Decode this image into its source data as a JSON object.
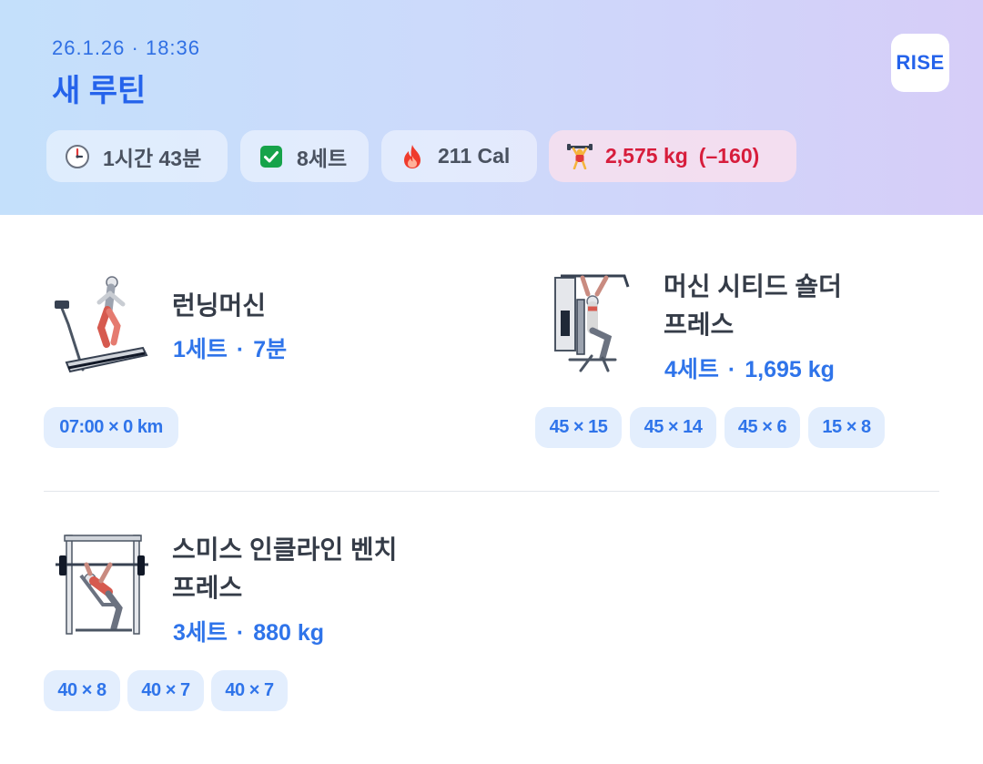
{
  "header": {
    "datetime": "26.1.26 · 18:36",
    "title": "새 루틴",
    "logo": "RISE",
    "stats": {
      "duration": "1시간 43분",
      "sets": "8세트",
      "calories": "211 Cal",
      "weight": "2,575 kg",
      "weight_delta": "(–160)"
    },
    "icons": {
      "duration": "clock-icon",
      "sets": "checkbox-icon",
      "calories": "fire-icon",
      "weight": "muscle-figure-icon"
    }
  },
  "exercises": [
    {
      "name_line1": "런닝머신",
      "name_line2": "",
      "meta_sets": "1세트",
      "meta_value": "7분",
      "sets": [
        "07:00 × 0 km"
      ]
    },
    {
      "name_line1": "머신 시티드 숄더",
      "name_line2": "프레스",
      "meta_sets": "4세트",
      "meta_value": "1,695 kg",
      "sets": [
        "45 × 15",
        "45 × 14",
        "45 × 6",
        "15 × 8"
      ]
    },
    {
      "name_line1": "스미스 인클라인 벤치",
      "name_line2": "프레스",
      "meta_sets": "3세트",
      "meta_value": "880 kg",
      "sets": [
        "40 × 8",
        "40 × 7",
        "40 × 7"
      ]
    }
  ],
  "meta_separator": "·",
  "colors": {
    "accent": "#2563eb",
    "accent_text": "#2f74ea",
    "pill_bg": "#e3eefd",
    "weight_red": "#d71d3c"
  }
}
